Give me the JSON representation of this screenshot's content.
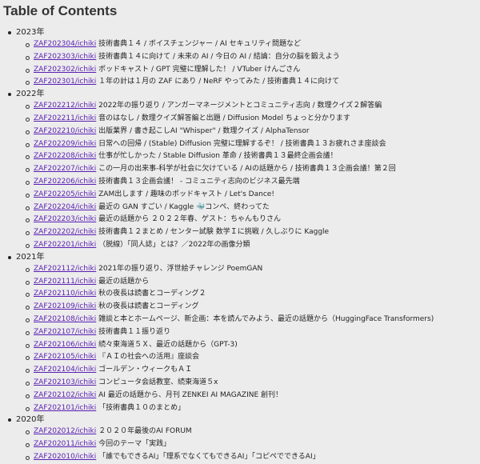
{
  "title": "Table of Contents",
  "years": [
    {
      "label": "2023年",
      "items": [
        {
          "link": "ZAF202304/ichiki",
          "text": "技術書典１４ / ボイスチェンジャー / AI セキュリティ問題など"
        },
        {
          "link": "ZAF202303/ichiki",
          "text": "技術書典１４に向けて / 未来の AI / 今日の AI / 結論：自分の脳を鍛えよう"
        },
        {
          "link": "ZAF202302/ichiki",
          "text": "ポッドキャスト / GPT 完璧に理解した！ / VTuber けんごさん"
        },
        {
          "link": "ZAF202301/ichiki",
          "text": "１年の計は１月の ZAF にあり / NeRF やってみた / 技術書典１４に向けて"
        }
      ]
    },
    {
      "label": "2022年",
      "items": [
        {
          "link": "ZAF202212/ichiki",
          "text": "2022年の振り返り / アンガーマネージメントとコミュニティ志向 / 数理クイズ２解答編"
        },
        {
          "link": "ZAF202211/ichiki",
          "text": "音のはなし / 数理クイズ解答編と出題 / Diffusion Model ちょっと分かります"
        },
        {
          "link": "ZAF202210/ichiki",
          "text": "出版業界 / 書き起こしAI \"Whisper\" / 数理クイズ / AlphaTensor"
        },
        {
          "link": "ZAF202209/ichiki",
          "text": "日常への回帰 / (Stable) Diffusion 完璧に理解するぞ！ / 技術書典１３お疲れさま座談会"
        },
        {
          "link": "ZAF202208/ichiki",
          "text": "仕事が忙しかった / Stable Diffusion 革命 / 技術書典１３最終企画会議！"
        },
        {
          "link": "ZAF202207/ichiki",
          "text": "この一月の出来事-科学が社会に欠けている / AIの話題から / 技術書典１３企画会議！第２回"
        },
        {
          "link": "ZAF202206/ichiki",
          "text": "技術書典１３企画会議！ - コミュニティ志向のビジネス最先端"
        },
        {
          "link": "ZAF202205/ichiki",
          "text": "ZAM出します / 趣味のポッドキャスト / Let's Dance!"
        },
        {
          "link": "ZAF202204/ichiki",
          "text": "最近の GAN すごい / Kaggle 🐳コンペ、終わってた"
        },
        {
          "link": "ZAF202203/ichiki",
          "text": "最近の話題から ２０２２年春、ゲスト：ちゃんもりさん"
        },
        {
          "link": "ZAF202202/ichiki",
          "text": "技術書典１２まとめ / センター試験 数学Ｉに挑戦 / 久しぶりに Kaggle"
        },
        {
          "link": "ZAF202201/ichiki",
          "text": "（脱線）「同人誌」とは？／2022年の画像分類"
        }
      ]
    },
    {
      "label": "2021年",
      "items": [
        {
          "link": "ZAF202112/ichiki",
          "text": "2021年の振り返り、浮世絵チャレンジ PoemGAN"
        },
        {
          "link": "ZAF202111/ichiki",
          "text": "最近の話題から"
        },
        {
          "link": "ZAF202110/ichiki",
          "text": "秋の夜長は読書とコーディング２"
        },
        {
          "link": "ZAF202109/ichiki",
          "text": "秋の夜長は読書とコーディング"
        },
        {
          "link": "ZAF202108/ichiki",
          "text": "雑談と本とホームページ、新企画：本を読んでみよう、最近の話題から（HuggingFace Transformers)"
        },
        {
          "link": "ZAF202107/ichiki",
          "text": "技術書典１１振り返り"
        },
        {
          "link": "ZAF202106/ichiki",
          "text": "続々東海道５Ｘ、最近の話題から（GPT-3)"
        },
        {
          "link": "ZAF202105/ichiki",
          "text": "『ＡＩの社会への活用』座談会"
        },
        {
          "link": "ZAF202104/ichiki",
          "text": "ゴールデン・ウィークもＡＩ"
        },
        {
          "link": "ZAF202103/ichiki",
          "text": "コンピュータ会話教室、続東海道５x"
        },
        {
          "link": "ZAF202102/ichiki",
          "text": "AI 最近の話題から、月刊 ZENKEI AI MAGAZINE 創刊！"
        },
        {
          "link": "ZAF202101/ichiki",
          "text": "「技術書典１０のまとめ」"
        }
      ]
    },
    {
      "label": "2020年",
      "items": [
        {
          "link": "ZAF202012/ichiki",
          "text": "２０２０年最後のAI FORUM"
        },
        {
          "link": "ZAF202011/ichiki",
          "text": "今回のテーマ「実践」"
        },
        {
          "link": "ZAF202010/ichiki",
          "text": "「誰でもできるAI」「理系でなくてもできるAI」「コピペでできるAI」"
        }
      ]
    }
  ]
}
